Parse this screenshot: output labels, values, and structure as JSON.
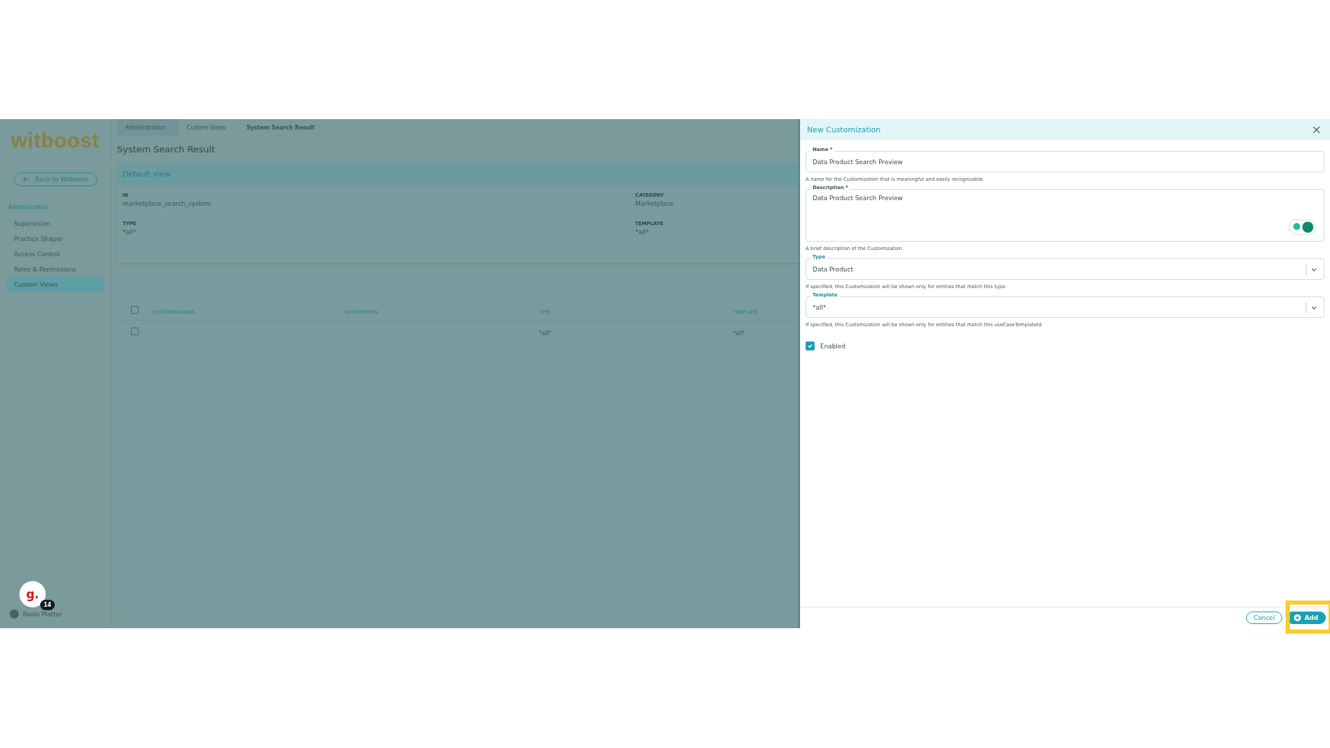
{
  "sidebar": {
    "logo": "witboost",
    "back_button": "Back to Witboost",
    "section": "Administration",
    "items": [
      {
        "label": "Supervision",
        "selected": false
      },
      {
        "label": "Practice Shaper",
        "selected": false
      },
      {
        "label": "Access Control",
        "selected": false
      },
      {
        "label": "Roles & Permissions",
        "selected": false
      },
      {
        "label": "Custom Views",
        "selected": true
      }
    ],
    "user": {
      "name": "Paolo Platter"
    },
    "assistant": {
      "glyph": "g.",
      "badge": "14"
    }
  },
  "breadcrumbs": [
    "Administration",
    "Custom Views",
    "System Search Result"
  ],
  "page_title": "System Search Result",
  "details": {
    "title": "Default view",
    "fields": [
      {
        "label": "ID",
        "value": "marketplace_search_system"
      },
      {
        "label": "CATEGORY",
        "value": "Marketplace"
      },
      {
        "label": "TYPE",
        "value": "*all*"
      },
      {
        "label": "TEMPLATE",
        "value": "*all*"
      }
    ]
  },
  "table": {
    "columns": [
      "CUSTOMIZATIONS",
      "DESCRIPTION",
      "TYPE",
      "TEMPLATE"
    ],
    "header_checked": false,
    "rows": [
      {
        "checked": false,
        "cells": [
          "",
          "",
          "*all*",
          "*all*"
        ]
      }
    ]
  },
  "drawer": {
    "title": "New Customization",
    "fields": [
      {
        "kind": "text",
        "label": "Name *",
        "value": "Data Product Search Preview",
        "help": "A name for the Customization that is meaningful and easily recognizable."
      },
      {
        "kind": "textarea",
        "label": "Description *",
        "value": "Data Product Search Preview",
        "help": "A brief description of the Customization."
      },
      {
        "kind": "select",
        "label": "Type",
        "value": "Data Product",
        "help": "If specified, this Customization will be shown only for entities that match this type."
      },
      {
        "kind": "select",
        "label": "Template",
        "value": "*all*",
        "help": "If specified, this Customization will be shown only for entities that match this useCaseTemplateId."
      }
    ],
    "enabled": {
      "label": "Enabled",
      "checked": true
    },
    "buttons": [
      {
        "kind": "secondary",
        "label": "Cancel"
      },
      {
        "kind": "primary",
        "label": "Add"
      }
    ]
  }
}
